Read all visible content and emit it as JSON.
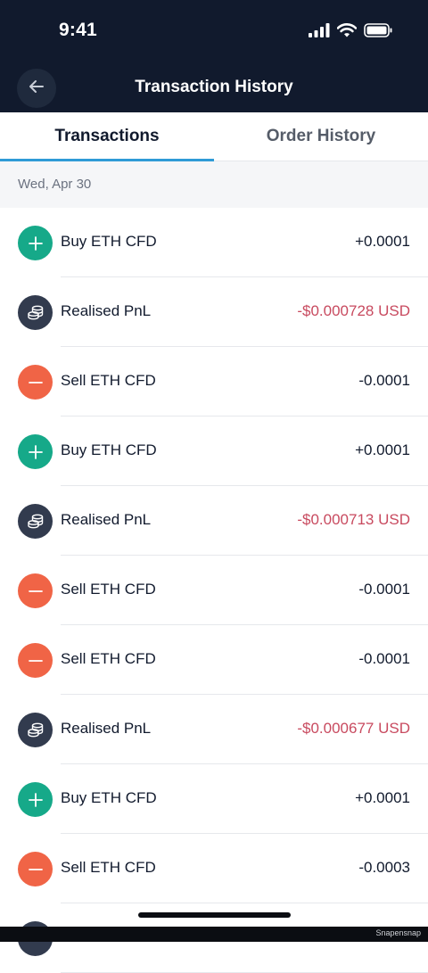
{
  "status_bar": {
    "time": "9:41",
    "icons": [
      "signal-icon",
      "wifi-icon",
      "battery-icon"
    ]
  },
  "header": {
    "title": "Transaction History",
    "back_icon": "arrow-left-icon"
  },
  "tabs": [
    {
      "label": "Transactions",
      "active": true
    },
    {
      "label": "Order History",
      "active": false
    }
  ],
  "date_group": "Wed, Apr 30",
  "transactions": [
    {
      "type": "buy",
      "icon": "plus-icon",
      "label": "Buy ETH CFD",
      "amount": "+0.0001"
    },
    {
      "type": "pnl",
      "icon": "coins-icon",
      "label": "Realised PnL",
      "amount": "-$0.000728 USD"
    },
    {
      "type": "sell",
      "icon": "minus-icon",
      "label": "Sell ETH CFD",
      "amount": "-0.0001"
    },
    {
      "type": "buy",
      "icon": "plus-icon",
      "label": "Buy ETH CFD",
      "amount": "+0.0001"
    },
    {
      "type": "pnl",
      "icon": "coins-icon",
      "label": "Realised PnL",
      "amount": "-$0.000713 USD"
    },
    {
      "type": "sell",
      "icon": "minus-icon",
      "label": "Sell ETH CFD",
      "amount": "-0.0001"
    },
    {
      "type": "sell",
      "icon": "minus-icon",
      "label": "Sell ETH CFD",
      "amount": "-0.0001"
    },
    {
      "type": "pnl",
      "icon": "coins-icon",
      "label": "Realised PnL",
      "amount": "-$0.000677 USD"
    },
    {
      "type": "buy",
      "icon": "plus-icon",
      "label": "Buy ETH CFD",
      "amount": "+0.0001"
    },
    {
      "type": "sell",
      "icon": "minus-icon",
      "label": "Sell ETH CFD",
      "amount": "-0.0003"
    }
  ],
  "colors": {
    "header_bg": "#111a2d",
    "buy": "#16a989",
    "sell": "#f06446",
    "pnl": "#323b4e",
    "negative_usd": "#c84a5f",
    "tab_indicator": "#2f9bd6"
  },
  "watermark": "Snapensnap"
}
